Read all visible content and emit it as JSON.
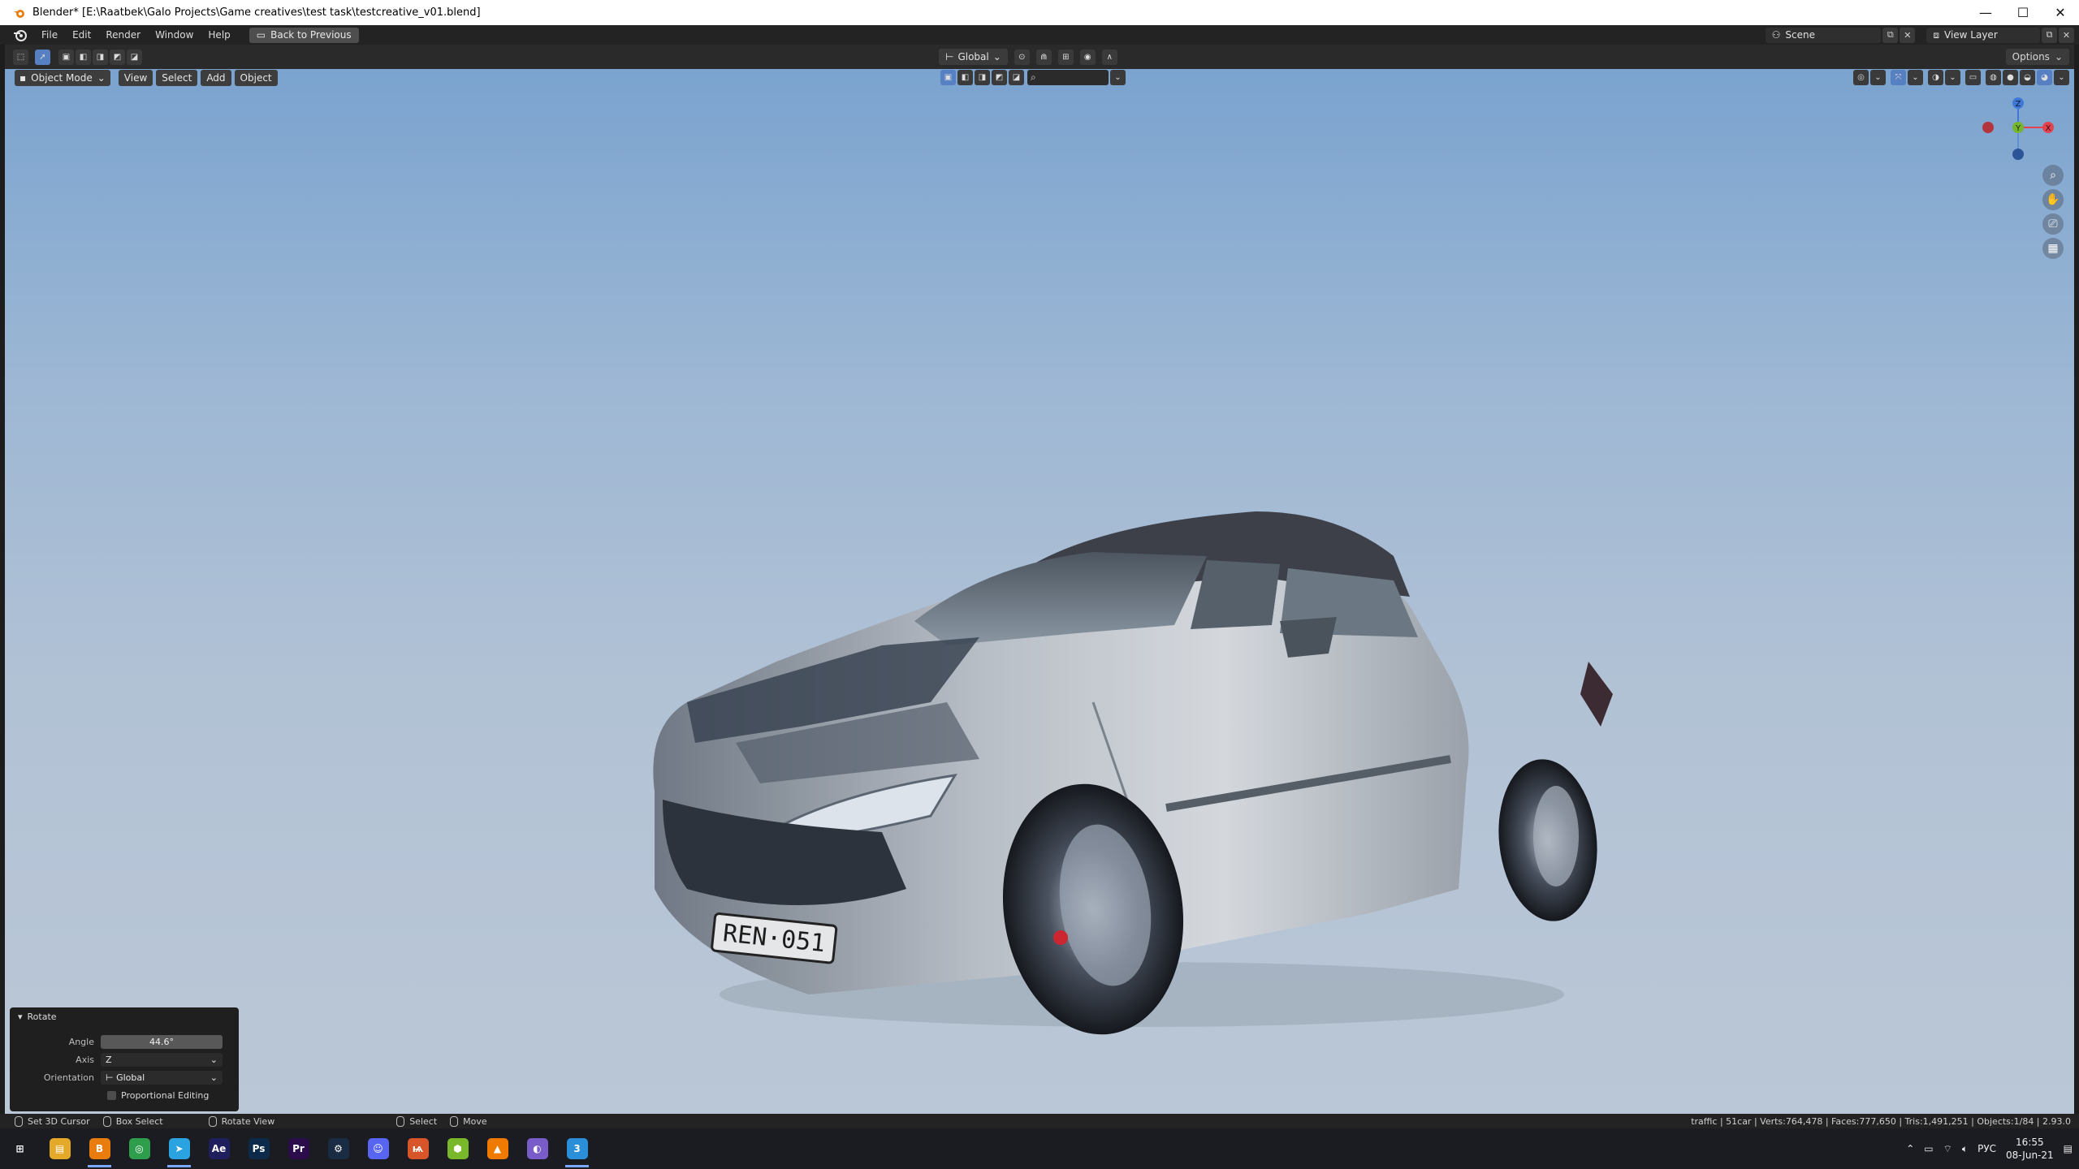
{
  "window": {
    "title": "Blender* [E:\\Raatbek\\Galo Projects\\Game creatives\\test task\\testcreative_v01.blend]",
    "minimize": "—",
    "maximize": "☐",
    "close": "✕"
  },
  "menubar": {
    "items": [
      "File",
      "Edit",
      "Render",
      "Window",
      "Help"
    ],
    "back_button": "Back to Previous",
    "scene": "Scene",
    "view_layer": "View Layer"
  },
  "toolheader": {
    "transform_orientation": "Global",
    "options": "Options"
  },
  "viewport_header": {
    "mode": "Object Mode",
    "menus": [
      "View",
      "Select",
      "Add",
      "Object"
    ]
  },
  "scene_content": {
    "license_plate": "REN·051"
  },
  "gizmo": {
    "x_label": "X",
    "y_label": "Y",
    "z_label": "Z",
    "colors": {
      "x": "#e2434f",
      "y": "#75b530",
      "z": "#3f78d6"
    }
  },
  "operator_panel": {
    "title": "Rotate",
    "angle_label": "Angle",
    "angle_value": "44.6°",
    "axis_label": "Axis",
    "axis_value": "Z",
    "orientation_label": "Orientation",
    "orientation_value": "Global",
    "proportional_label": "Proportional Editing"
  },
  "statusbar": {
    "items": [
      "Set 3D Cursor",
      "Box Select",
      "Rotate View",
      "Select",
      "Move"
    ],
    "stats": "traffic | 51car | Verts:764,478 | Faces:777,650 | Tris:1,491,251 | Objects:1/84 | 2.93.0"
  },
  "taskbar": {
    "apps": [
      {
        "name": "windows-start",
        "glyph": "⊞",
        "color": "#1b1b22"
      },
      {
        "name": "file-explorer",
        "glyph": "▤",
        "color": "#e5a92a"
      },
      {
        "name": "blender",
        "glyph": "B",
        "color": "#e87d0d"
      },
      {
        "name": "chrome",
        "glyph": "◎",
        "color": "#2e9e4c"
      },
      {
        "name": "telegram",
        "glyph": "➤",
        "color": "#2aa3e0"
      },
      {
        "name": "after-effects",
        "glyph": "Ae",
        "color": "#1f1f5e"
      },
      {
        "name": "photoshop",
        "glyph": "Ps",
        "color": "#0d2a4a"
      },
      {
        "name": "premiere",
        "glyph": "Pr",
        "color": "#2a0d4a"
      },
      {
        "name": "steam",
        "glyph": "⚙",
        "color": "#1a2c44"
      },
      {
        "name": "discord",
        "glyph": "☺",
        "color": "#5865f2"
      },
      {
        "name": "houdini",
        "glyph": "ѩ",
        "color": "#d8552a"
      },
      {
        "name": "android",
        "glyph": "⬢",
        "color": "#79b82b"
      },
      {
        "name": "app-orange",
        "glyph": "▲",
        "color": "#ef7a00"
      },
      {
        "name": "browser",
        "glyph": "◐",
        "color": "#7a5cc8"
      },
      {
        "name": "app-3",
        "glyph": "3",
        "color": "#2a8fd8"
      }
    ],
    "language": "РУС",
    "time": "16:55",
    "date": "08-Jun-21"
  }
}
